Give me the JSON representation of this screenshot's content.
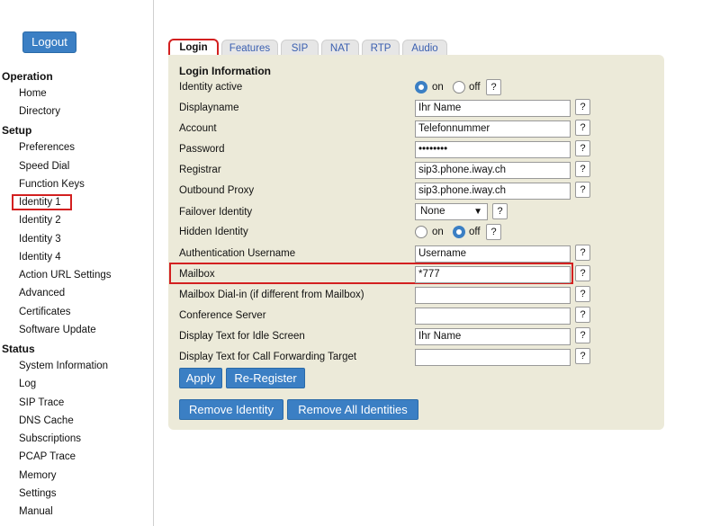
{
  "sidebar": {
    "logout": "Logout",
    "sections": {
      "operation": "Operation",
      "setup": "Setup",
      "status": "Status"
    },
    "operation_items": [
      "Home",
      "Directory"
    ],
    "setup_items": [
      "Preferences",
      "Speed Dial",
      "Function Keys",
      "Identity 1",
      "Identity 2",
      "Identity 3",
      "Identity 4",
      "Action URL Settings",
      "Advanced",
      "Certificates",
      "Software Update"
    ],
    "status_items": [
      "System Information",
      "Log",
      "SIP Trace",
      "DNS Cache",
      "Subscriptions",
      "PCAP Trace",
      "Memory",
      "Settings",
      "Manual"
    ]
  },
  "tabs": [
    "Login",
    "Features",
    "SIP",
    "NAT",
    "RTP",
    "Audio"
  ],
  "form": {
    "title": "Login Information",
    "help": "?",
    "fields": {
      "identity_active": {
        "label": "Identity active",
        "on": "on",
        "off": "off",
        "selected": "on"
      },
      "displayname": {
        "label": "Displayname",
        "value": "Ihr Name"
      },
      "account": {
        "label": "Account",
        "value": "Telefonnummer"
      },
      "password": {
        "label": "Password",
        "value": "••••••••"
      },
      "registrar": {
        "label": "Registrar",
        "value": "sip3.phone.iway.ch"
      },
      "outbound_proxy": {
        "label": "Outbound Proxy",
        "value": "sip3.phone.iway.ch"
      },
      "failover_identity": {
        "label": "Failover Identity",
        "value": "None"
      },
      "hidden_identity": {
        "label": "Hidden Identity",
        "on": "on",
        "off": "off",
        "selected": "off"
      },
      "auth_username": {
        "label": "Authentication Username",
        "value": "Username"
      },
      "mailbox": {
        "label": "Mailbox",
        "value": "*777"
      },
      "mailbox_dialin": {
        "label": "Mailbox Dial-in (if different from Mailbox)",
        "value": ""
      },
      "conference_server": {
        "label": "Conference Server",
        "value": ""
      },
      "idle_text": {
        "label": "Display Text for Idle Screen",
        "value": "Ihr Name"
      },
      "call_forward_text": {
        "label": "Display Text for Call Forwarding Target",
        "value": ""
      }
    },
    "buttons": {
      "apply": "Apply",
      "reregister": "Re-Register",
      "remove_identity": "Remove Identity",
      "remove_all": "Remove All Identities"
    }
  },
  "colors": {
    "accent": "#3b7fc4",
    "highlight": "#d32020",
    "panel": "#ecead9"
  }
}
